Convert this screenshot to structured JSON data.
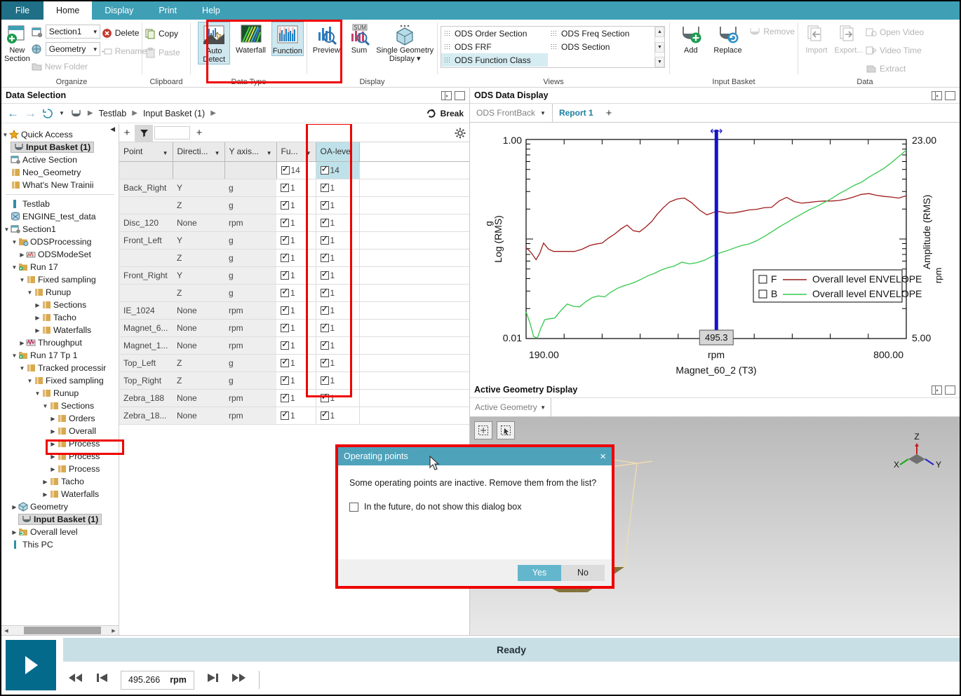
{
  "ribbon": {
    "tabs": [
      {
        "label": "File",
        "kind": "file"
      },
      {
        "label": "Home",
        "active": true
      },
      {
        "label": "Display"
      },
      {
        "label": "Print"
      },
      {
        "label": "Help"
      }
    ],
    "groups": {
      "organize": {
        "title": "Organize",
        "new_section": "New\nSection",
        "new_section_l1": "New",
        "new_section_l2": "Section",
        "section_combo": "Section1",
        "geometry_combo": "Geometry",
        "delete": "Delete",
        "rename": "Rename",
        "new_folder": "New Folder"
      },
      "clipboard": {
        "title": "Clipboard",
        "copy": "Copy",
        "paste": "Paste"
      },
      "data_type": {
        "title": "Data Type",
        "auto_detect_l1": "Auto",
        "auto_detect_l2": "Detect",
        "waterfall": "Waterfall",
        "function": "Function"
      },
      "display": {
        "title": "Display",
        "preview": "Preview",
        "sum": "Sum",
        "single_geometry_l1": "Single Geometry",
        "single_geometry_l2": "Display"
      },
      "views": {
        "title": "Views",
        "items": [
          "ODS Order Section",
          "ODS FRF",
          "ODS Function Class",
          "ODS Freq Section",
          "ODS Section"
        ],
        "selected": "ODS Function Class"
      },
      "input_basket": {
        "title": "Input Basket",
        "add": "Add",
        "replace": "Replace",
        "remove": "Remove"
      },
      "data": {
        "title": "Data",
        "import": "Import",
        "export": "Export...",
        "open_video": "Open Video",
        "video_time": "Video Time",
        "extract": "Extract"
      }
    }
  },
  "data_selection": {
    "panel_title": "Data Selection",
    "breadcrumbs": [
      "Testlab",
      "Input Basket (1)"
    ],
    "break_label": "Break",
    "tree": {
      "quick_access": {
        "label": "Quick Access",
        "items": [
          {
            "label": "Input Basket (1)",
            "icon": "basket-icon",
            "selected": true,
            "bold": true
          },
          {
            "label": "Active Section",
            "icon": "section-icon"
          },
          {
            "label": "Neo_Geometry",
            "icon": "folder-icon"
          },
          {
            "label": "What's New Trainii",
            "icon": "folder-icon"
          }
        ]
      },
      "nodes": [
        {
          "label": "Testlab",
          "depth": 0,
          "twisty": "",
          "icon": "testlab-icon"
        },
        {
          "label": "ENGINE_test_data",
          "depth": 0,
          "twisty": "",
          "icon": "db-icon"
        },
        {
          "label": "Section1",
          "depth": 0,
          "twisty": "open",
          "icon": "section-icon"
        },
        {
          "label": "ODSProcessing",
          "depth": 1,
          "twisty": "open",
          "icon": "folder-gear-icon"
        },
        {
          "label": "ODSModeSet",
          "depth": 2,
          "twisty": "closed",
          "icon": "modeset-icon"
        },
        {
          "label": "Run 17",
          "depth": 1,
          "twisty": "open",
          "icon": "run-icon"
        },
        {
          "label": "Fixed sampling",
          "depth": 2,
          "twisty": "open",
          "icon": "folder-icon"
        },
        {
          "label": "Runup",
          "depth": 3,
          "twisty": "open",
          "icon": "folder-icon"
        },
        {
          "label": "Sections",
          "depth": 4,
          "twisty": "closed",
          "icon": "folder-icon"
        },
        {
          "label": "Tacho",
          "depth": 4,
          "twisty": "closed",
          "icon": "folder-icon"
        },
        {
          "label": "Waterfalls",
          "depth": 4,
          "twisty": "closed",
          "icon": "folder-icon"
        },
        {
          "label": "Throughput",
          "depth": 2,
          "twisty": "closed",
          "icon": "throughput-icon"
        },
        {
          "label": "Run 17 Tp 1",
          "depth": 1,
          "twisty": "open",
          "icon": "run-icon"
        },
        {
          "label": "Tracked processir",
          "depth": 2,
          "twisty": "open",
          "icon": "folder-icon"
        },
        {
          "label": "Fixed sampling",
          "depth": 3,
          "twisty": "open",
          "icon": "folder-icon"
        },
        {
          "label": "Runup",
          "depth": 4,
          "twisty": "open",
          "icon": "folder-icon"
        },
        {
          "label": "Sections",
          "depth": 5,
          "twisty": "open",
          "icon": "folder-icon"
        },
        {
          "label": "Orders",
          "depth": 6,
          "twisty": "closed",
          "icon": "folder-icon"
        },
        {
          "label": "Overall",
          "depth": 6,
          "twisty": "closed",
          "icon": "folder-icon",
          "highlight": true
        },
        {
          "label": "Process",
          "depth": 6,
          "twisty": "closed",
          "icon": "folder-icon"
        },
        {
          "label": "Process",
          "depth": 6,
          "twisty": "closed",
          "icon": "folder-icon"
        },
        {
          "label": "Process",
          "depth": 6,
          "twisty": "closed",
          "icon": "folder-icon"
        },
        {
          "label": "Tacho",
          "depth": 5,
          "twisty": "closed",
          "icon": "folder-icon"
        },
        {
          "label": "Waterfalls",
          "depth": 5,
          "twisty": "closed",
          "icon": "folder-icon"
        },
        {
          "label": "Geometry",
          "depth": 1,
          "twisty": "closed",
          "icon": "cube-icon"
        },
        {
          "label": "Input Basket (1)",
          "depth": 1,
          "twisty": "",
          "icon": "basket-icon",
          "bold": true,
          "selected": true
        },
        {
          "label": "Overall level",
          "depth": 1,
          "twisty": "closed",
          "icon": "overall-icon"
        },
        {
          "label": "This PC",
          "depth": 0,
          "twisty": "",
          "icon": "pc-icon"
        }
      ]
    },
    "table": {
      "columns": [
        "Point",
        "Directi...",
        "Y axis...",
        "Fu...",
        "OA-level"
      ],
      "header_counts": {
        "function": "14",
        "oa_level": "14"
      },
      "rows": [
        {
          "point": "Back_Right",
          "direction": "Y",
          "yaxis": "g",
          "fn": "1",
          "oa": "1"
        },
        {
          "point": "",
          "direction": "Z",
          "yaxis": "g",
          "fn": "1",
          "oa": "1"
        },
        {
          "point": "Disc_120",
          "direction": "None",
          "yaxis": "rpm",
          "fn": "1",
          "oa": "1"
        },
        {
          "point": "Front_Left",
          "direction": "Y",
          "yaxis": "g",
          "fn": "1",
          "oa": "1"
        },
        {
          "point": "",
          "direction": "Z",
          "yaxis": "g",
          "fn": "1",
          "oa": "1"
        },
        {
          "point": "Front_Right",
          "direction": "Y",
          "yaxis": "g",
          "fn": "1",
          "oa": "1"
        },
        {
          "point": "",
          "direction": "Z",
          "yaxis": "g",
          "fn": "1",
          "oa": "1"
        },
        {
          "point": "IE_1024",
          "direction": "None",
          "yaxis": "rpm",
          "fn": "1",
          "oa": "1"
        },
        {
          "point": "Magnet_6...",
          "direction": "None",
          "yaxis": "rpm",
          "fn": "1",
          "oa": "1"
        },
        {
          "point": "Magnet_1...",
          "direction": "None",
          "yaxis": "rpm",
          "fn": "1",
          "oa": "1"
        },
        {
          "point": "Top_Left",
          "direction": "Z",
          "yaxis": "g",
          "fn": "1",
          "oa": "1"
        },
        {
          "point": "Top_Right",
          "direction": "Z",
          "yaxis": "g",
          "fn": "1",
          "oa": "1"
        },
        {
          "point": "Zebra_188",
          "direction": "None",
          "yaxis": "rpm",
          "fn": "1",
          "oa": "1"
        },
        {
          "point": "Zebra_18...",
          "direction": "None",
          "yaxis": "rpm",
          "fn": "1",
          "oa": "1"
        }
      ]
    }
  },
  "ods_display": {
    "panel_title": "ODS Data Display",
    "tabs": [
      {
        "label": "ODS FrontBack",
        "has_caret": true,
        "active": false
      },
      {
        "label": "Report 1",
        "active": true
      }
    ],
    "add_tab": "+"
  },
  "chart_data": {
    "type": "line",
    "title": "",
    "xlabel": "rpm",
    "sub_xlabel": "Magnet_60_2 (T3)",
    "ylabel_left_top": "g",
    "ylabel_left": "Log (RMS)",
    "ylabel_right": "Amplitude (RMS)",
    "ylabel_right_unit": "rpm",
    "xlim": [
      190.0,
      800.0
    ],
    "xtick_labels": [
      "190.00",
      "800.00"
    ],
    "ylim_left": [
      0.01,
      1.0
    ],
    "ytick_labels_left": [
      "0.01",
      "1.00"
    ],
    "ylim_right": [
      5.0,
      23.0
    ],
    "ytick_labels_right": [
      "5.00",
      "23.00"
    ],
    "yscale": "log",
    "grid": false,
    "cursor": {
      "value": "495.3",
      "x": 495.3
    },
    "legend_position": "bottom-right",
    "series": [
      {
        "name": "Overall level ENVELOPE",
        "legend_prefix": "F",
        "color": "#9e1b1b",
        "axis": "left",
        "x": [
          190,
          198,
          206,
          212,
          218,
          226,
          234,
          244,
          256,
          268,
          280,
          292,
          302,
          312,
          322,
          332,
          342,
          352,
          362,
          372,
          382,
          392,
          400,
          410,
          420,
          432,
          444,
          456,
          468,
          480,
          492,
          500,
          512,
          524,
          536,
          548,
          560,
          572,
          584,
          596,
          608,
          620,
          632,
          644,
          656,
          668,
          680,
          692,
          704,
          716,
          728,
          740,
          752,
          764,
          776,
          788,
          800
        ],
        "y": [
          0.082,
          0.073,
          0.062,
          0.072,
          0.091,
          0.079,
          0.075,
          0.075,
          0.075,
          0.075,
          0.079,
          0.086,
          0.089,
          0.091,
          0.102,
          0.112,
          0.126,
          0.138,
          0.121,
          0.118,
          0.132,
          0.151,
          0.176,
          0.206,
          0.235,
          0.252,
          0.258,
          0.231,
          0.196,
          0.175,
          0.186,
          0.189,
          0.182,
          0.183,
          0.189,
          0.196,
          0.199,
          0.206,
          0.208,
          0.241,
          0.262,
          0.238,
          0.229,
          0.233,
          0.238,
          0.241,
          0.241,
          0.244,
          0.252,
          0.265,
          0.281,
          0.286,
          0.275,
          0.268,
          0.264,
          0.258,
          0.272
        ]
      },
      {
        "name": "Overall level ENVELOPE",
        "legend_prefix": "B",
        "color": "#35c84b",
        "axis": "left",
        "x": [
          190,
          196,
          202,
          208,
          214,
          220,
          228,
          236,
          246,
          256,
          266,
          276,
          286,
          296,
          306,
          316,
          326,
          336,
          346,
          356,
          366,
          376,
          386,
          396,
          406,
          416,
          428,
          440,
          452,
          464,
          476,
          488,
          500,
          512,
          524,
          536,
          548,
          560,
          572,
          584,
          596,
          608,
          620,
          632,
          644,
          656,
          668,
          680,
          692,
          704,
          716,
          728,
          740,
          752,
          764,
          776,
          788,
          800
        ],
        "y": [
          0.0185,
          0.0145,
          0.0105,
          0.0101,
          0.0128,
          0.0155,
          0.0158,
          0.0161,
          0.0192,
          0.0222,
          0.0211,
          0.0208,
          0.0235,
          0.0258,
          0.0268,
          0.0262,
          0.0292,
          0.0318,
          0.0338,
          0.0352,
          0.0372,
          0.0398,
          0.0428,
          0.0452,
          0.0486,
          0.0512,
          0.0536,
          0.0586,
          0.0562,
          0.0578,
          0.0612,
          0.0668,
          0.0722,
          0.0762,
          0.0812,
          0.0862,
          0.0892,
          0.0962,
          0.106,
          0.118,
          0.132,
          0.146,
          0.162,
          0.178,
          0.196,
          0.212,
          0.232,
          0.255,
          0.285,
          0.312,
          0.345,
          0.372,
          0.418,
          0.462,
          0.512,
          0.585,
          0.675,
          0.78
        ]
      }
    ]
  },
  "geometry": {
    "panel_title": "Active Geometry Display",
    "combo_label": "Active Geometry",
    "axis_labels": {
      "x": "X",
      "y": "Y",
      "z": "Z"
    }
  },
  "dialog": {
    "title": "Operating points",
    "message": "Some operating points are inactive. Remove them from the list?",
    "checkbox_label": "In the future, do not show this dialog box",
    "buttons": {
      "yes": "Yes",
      "no": "No"
    },
    "close": "×"
  },
  "status": {
    "ready": "Ready",
    "rpm_value": "495.266",
    "rpm_unit": "rpm"
  },
  "colors": {
    "accent": "#3e9fb5",
    "file_tab": "#1f6f86",
    "highlight_red": "#ee0000",
    "series_f": "#9e1b1b",
    "series_b": "#35c84b",
    "cursor_blue": "#1414c8"
  }
}
